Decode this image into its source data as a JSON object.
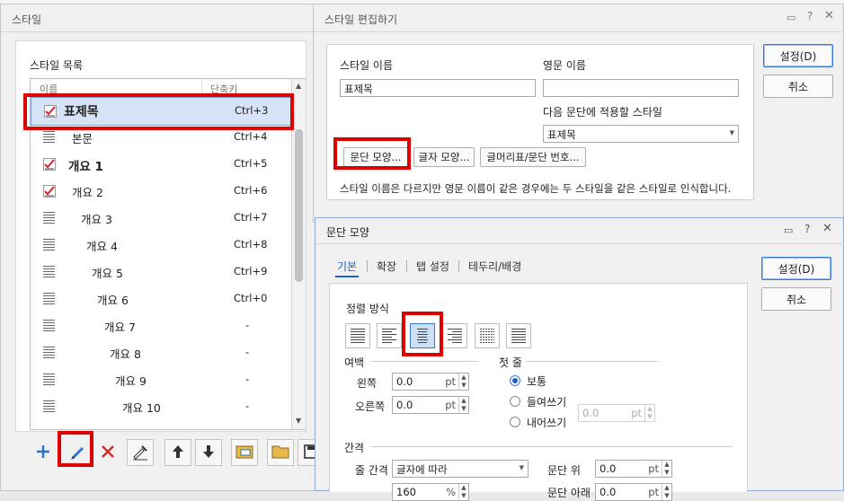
{
  "style_window": {
    "title": "스타일",
    "list_label": "스타일 목록",
    "col_name": "이름",
    "col_shortcut": "단축키",
    "items": [
      {
        "name": "표제목",
        "shortcut": "Ctrl+3",
        "icon": "character-style-icon"
      },
      {
        "name": "본문",
        "shortcut": "Ctrl+4",
        "icon": "paragraph-style-icon"
      },
      {
        "name": "개요 1",
        "shortcut": "Ctrl+5",
        "icon": "character-style-icon"
      },
      {
        "name": "개요 2",
        "shortcut": "Ctrl+6",
        "icon": "character-style-icon"
      },
      {
        "name": "개요 3",
        "shortcut": "Ctrl+7",
        "icon": "paragraph-style-icon"
      },
      {
        "name": "개요 4",
        "shortcut": "Ctrl+8",
        "icon": "paragraph-style-icon"
      },
      {
        "name": "개요 5",
        "shortcut": "Ctrl+9",
        "icon": "paragraph-style-icon"
      },
      {
        "name": "개요 6",
        "shortcut": "Ctrl+0",
        "icon": "paragraph-style-icon"
      },
      {
        "name": "개요 7",
        "shortcut": "-",
        "icon": "paragraph-style-icon"
      },
      {
        "name": "개요 8",
        "shortcut": "-",
        "icon": "paragraph-style-icon"
      },
      {
        "name": "개요 9",
        "shortcut": "-",
        "icon": "paragraph-style-icon"
      },
      {
        "name": "개요 10",
        "shortcut": "-",
        "icon": "paragraph-style-icon"
      }
    ],
    "toolbar_icons": [
      "add-icon",
      "edit-pencil-icon",
      "delete-x-icon",
      "style-eyedropper-icon",
      "move-up-arrow-icon",
      "move-down-arrow-icon",
      "import-folder-icon",
      "open-folder-icon",
      "save-icon"
    ]
  },
  "edit_window": {
    "title": "스타일 편집하기",
    "name_label": "스타일 이름",
    "name_value": "표제목",
    "eng_label": "영문 이름",
    "eng_value": "",
    "next_label": "다음 문단에 적용할 스타일",
    "next_value": "표제목",
    "btn_para": "문단 모양...",
    "btn_char": "글자 모양...",
    "btn_bullet": "글머리표/문단 번호...",
    "note": "스타일 이름은 다르지만 영문 이름이 같은 경우에는 두 스타일을 같은 스타일로 인식합니다.",
    "ok": "설정(D)",
    "cancel": "취소"
  },
  "para_window": {
    "title": "문단 모양",
    "tabs": [
      "기본",
      "확장",
      "탭 설정",
      "테두리/배경"
    ],
    "align_label": "정렬 방식",
    "margin_label": "여백",
    "left_label": "왼쪽",
    "left_value": "0.0",
    "right_label": "오른쪽",
    "right_value": "0.0",
    "unit_pt": "pt",
    "first_line_label": "첫 줄",
    "radio_normal": "보통",
    "radio_indent": "들여쓰기",
    "radio_outdent": "내어쓰기",
    "indent_value": "0.0",
    "spacing_label": "간격",
    "line_spacing_label": "줄 간격",
    "line_spacing_value": "글자에 따라",
    "line_percent_value": "160",
    "percent_unit": "%",
    "para_above_label": "문단 위",
    "para_above_value": "0.0",
    "para_below_label": "문단 아래",
    "para_below_value": "0.0",
    "ok": "설정(D)",
    "cancel": "취소"
  },
  "colors": {
    "highlight": "#e00000",
    "selection": "#d6e3f7",
    "primary_border": "#3b78d8"
  }
}
